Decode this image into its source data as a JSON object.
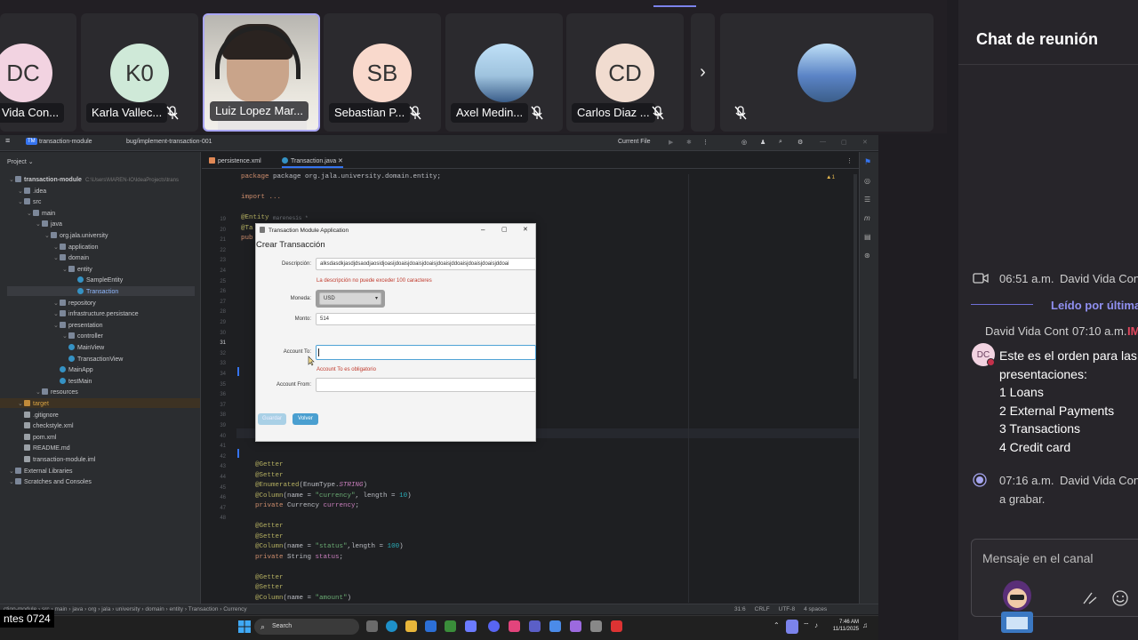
{
  "meeting": {
    "participants": [
      {
        "initials": "DC",
        "name": "Vida Con...",
        "color": "#f2d3e1",
        "muted": false
      },
      {
        "initials": "K0",
        "name": "Karla Vallec...",
        "color": "#cfe9d8",
        "muted": true
      },
      {
        "initials": "",
        "name": "Luiz Lopez Mar...",
        "color": "#8c8c90",
        "muted": false
      },
      {
        "initials": "SB",
        "name": "Sebastian P...",
        "color": "#f9d9cc",
        "muted": true
      },
      {
        "initials": "",
        "name": "Axel Medin...",
        "color": "#9fc3de",
        "muted": true
      },
      {
        "initials": "CD",
        "name": "Carlos Diaz ...",
        "color": "#f1dcd0",
        "muted": true
      },
      {
        "initials": "",
        "name": "",
        "color": "#5b84c6",
        "muted": true
      }
    ],
    "next_glyph": "›"
  },
  "chat": {
    "title": "Chat de reunión",
    "call_time": "06:51 a.m.",
    "call_author": "David Vida Cont",
    "read_label": "Leído por última",
    "msg_author": "David Vida Cont",
    "msg_time": "07:10 a.m.",
    "msg_tag": "IM",
    "avatar": "DC",
    "lines": [
      "Este es el orden para las",
      "presentaciones:",
      "1 Loans",
      "2 External Payments",
      "3 Transactions",
      "4 Credit card"
    ],
    "rec_time": "07:16 a.m.",
    "rec_author": "David Vida Cont",
    "rec_text": "a grabar.",
    "input_placeholder": "Mensaje en el canal"
  },
  "ide": {
    "project_icon": "TM",
    "project": "transaction-module",
    "branch": "bug/implement-transaction-001",
    "run_config": "Current File",
    "panel_title": "Project",
    "tree": [
      {
        "label": "transaction-module",
        "extra": "C:\\Users\\MAREN-IO\\IdeaProjects\\trans",
        "depth": 0,
        "kind": "folder"
      },
      {
        "label": ".idea",
        "depth": 1,
        "kind": "folder"
      },
      {
        "label": "src",
        "depth": 1,
        "kind": "folder"
      },
      {
        "label": "main",
        "depth": 2,
        "kind": "folder"
      },
      {
        "label": "java",
        "depth": 3,
        "kind": "folder"
      },
      {
        "label": "org.jala.university",
        "depth": 4,
        "kind": "folder"
      },
      {
        "label": "application",
        "depth": 5,
        "kind": "folder"
      },
      {
        "label": "domain",
        "depth": 5,
        "kind": "folder"
      },
      {
        "label": "entity",
        "depth": 6,
        "kind": "folder"
      },
      {
        "label": "SampleEntity",
        "depth": 7,
        "kind": "class"
      },
      {
        "label": "Transaction",
        "depth": 7,
        "kind": "class",
        "selected": true
      },
      {
        "label": "repository",
        "depth": 5,
        "kind": "folder"
      },
      {
        "label": "infrastructure.persistance",
        "depth": 5,
        "kind": "folder"
      },
      {
        "label": "presentation",
        "depth": 5,
        "kind": "folder"
      },
      {
        "label": "controller",
        "depth": 6,
        "kind": "folder"
      },
      {
        "label": "MainView",
        "depth": 6,
        "kind": "class"
      },
      {
        "label": "TransactionView",
        "depth": 6,
        "kind": "class"
      },
      {
        "label": "MainApp",
        "depth": 5,
        "kind": "class"
      },
      {
        "label": "testMain",
        "depth": 5,
        "kind": "class"
      },
      {
        "label": "resources",
        "depth": 3,
        "kind": "folder"
      },
      {
        "label": "target",
        "depth": 1,
        "kind": "folder",
        "orange": true
      },
      {
        "label": ".gitignore",
        "depth": 1,
        "kind": "file"
      },
      {
        "label": "checkstyle.xml",
        "depth": 1,
        "kind": "file"
      },
      {
        "label": "pom.xml",
        "depth": 1,
        "kind": "file"
      },
      {
        "label": "README.md",
        "depth": 1,
        "kind": "file"
      },
      {
        "label": "transaction-module.iml",
        "depth": 1,
        "kind": "file"
      },
      {
        "label": "External Libraries",
        "depth": 0,
        "kind": "folder"
      },
      {
        "label": "Scratches and Consoles",
        "depth": 0,
        "kind": "folder"
      }
    ],
    "tabs": [
      "persistence.xml",
      "Transaction.java"
    ],
    "code_package": "package org.jala.university.domain.entity;",
    "code_import": "import ...",
    "code_entity": "@Entity",
    "code_entity_hint": "marenesis *",
    "line_numbers": [
      "19",
      "20",
      "21",
      "22",
      "23",
      "24",
      "25",
      "26",
      "27",
      "28",
      "29",
      "30",
      "31",
      "32",
      "33",
      "34",
      "35",
      "36",
      "37",
      "38",
      "39",
      "40",
      "41",
      "42",
      "43",
      "44",
      "45",
      "46",
      "47",
      "48"
    ],
    "warn_count": "1",
    "status_path": [
      "ction-module",
      "src",
      "main",
      "java",
      "org",
      "jala",
      "university",
      "domain",
      "entity",
      "Transaction",
      "Currency"
    ],
    "status_right": [
      "31:6",
      "CRLF",
      "UTF-8",
      "4 spaces"
    ]
  },
  "dialog": {
    "window_title": "Transaction Module Application",
    "heading": "Crear Transacción",
    "desc_label": "Descripción:",
    "desc_value": "alksdasdkjasdjdsaodjaosidjoasijdoaisjdoaisjdoaisjdoaisjddoaisjdoaisjdoaisjddoai",
    "desc_error": "La descripción no puede exceder 100 caracteres",
    "currency_label": "Moneda:",
    "currency_value": "USD",
    "amount_label": "Monto:",
    "amount_value": "514",
    "to_label": "Account To:",
    "to_value": "",
    "to_error": "Account To es obligatorio",
    "from_label": "Account From:",
    "from_value": "",
    "save_label": "Guardar",
    "back_label": "Volver"
  },
  "taskbar": {
    "search": "Search",
    "time": "7:46 AM",
    "date": "11/11/2025"
  },
  "caption": "ntes 0724"
}
